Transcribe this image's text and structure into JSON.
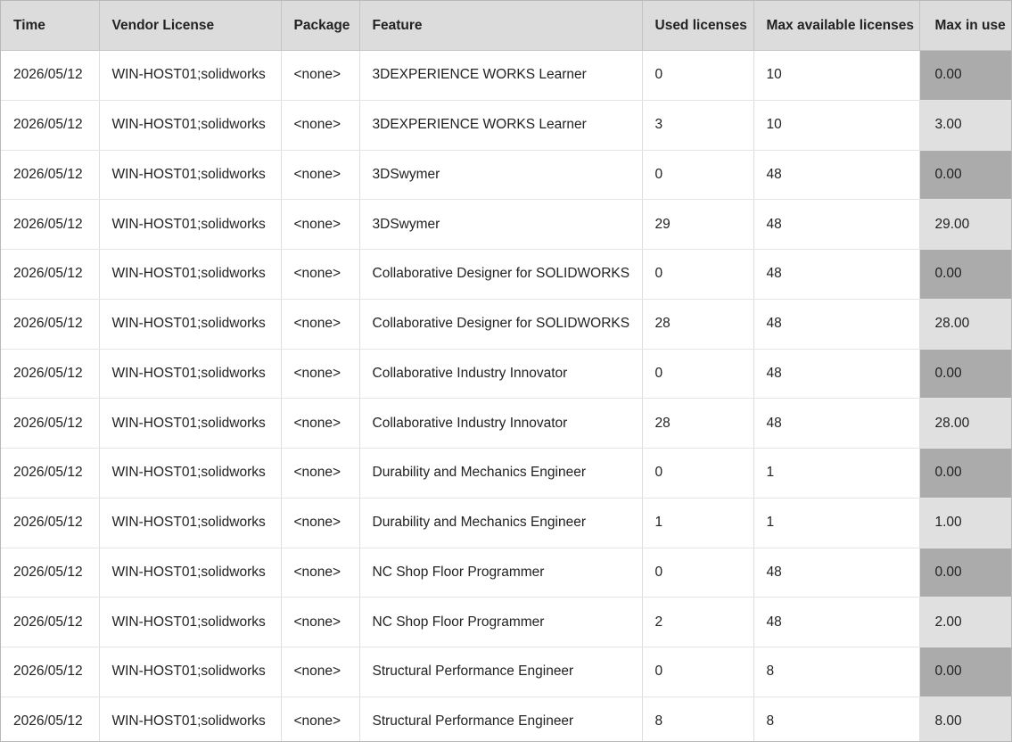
{
  "table": {
    "columns": [
      "Time",
      "Vendor License",
      "Package",
      "Feature",
      "Used licenses",
      "Max available licenses",
      "Max in use"
    ],
    "rows": [
      {
        "time": "2026/05/12",
        "vendor": "WIN-HOST01;solidworks",
        "package": "<none>",
        "feature": "3DEXPERIENCE WORKS Learner",
        "used": "0",
        "max": "10",
        "inuse": "0.00"
      },
      {
        "time": "2026/05/12",
        "vendor": "WIN-HOST01;solidworks",
        "package": "<none>",
        "feature": "3DEXPERIENCE WORKS Learner",
        "used": "3",
        "max": "10",
        "inuse": "3.00"
      },
      {
        "time": "2026/05/12",
        "vendor": "WIN-HOST01;solidworks",
        "package": "<none>",
        "feature": "3DSwymer",
        "used": "0",
        "max": "48",
        "inuse": "0.00"
      },
      {
        "time": "2026/05/12",
        "vendor": "WIN-HOST01;solidworks",
        "package": "<none>",
        "feature": "3DSwymer",
        "used": "29",
        "max": "48",
        "inuse": "29.00"
      },
      {
        "time": "2026/05/12",
        "vendor": "WIN-HOST01;solidworks",
        "package": "<none>",
        "feature": "Collaborative Designer for SOLIDWORKS",
        "used": "0",
        "max": "48",
        "inuse": "0.00"
      },
      {
        "time": "2026/05/12",
        "vendor": "WIN-HOST01;solidworks",
        "package": "<none>",
        "feature": "Collaborative Designer for SOLIDWORKS",
        "used": "28",
        "max": "48",
        "inuse": "28.00"
      },
      {
        "time": "2026/05/12",
        "vendor": "WIN-HOST01;solidworks",
        "package": "<none>",
        "feature": "Collaborative Industry Innovator",
        "used": "0",
        "max": "48",
        "inuse": "0.00"
      },
      {
        "time": "2026/05/12",
        "vendor": "WIN-HOST01;solidworks",
        "package": "<none>",
        "feature": "Collaborative Industry Innovator",
        "used": "28",
        "max": "48",
        "inuse": "28.00"
      },
      {
        "time": "2026/05/12",
        "vendor": "WIN-HOST01;solidworks",
        "package": "<none>",
        "feature": "Durability and Mechanics Engineer",
        "used": "0",
        "max": "1",
        "inuse": "0.00"
      },
      {
        "time": "2026/05/12",
        "vendor": "WIN-HOST01;solidworks",
        "package": "<none>",
        "feature": "Durability and Mechanics Engineer",
        "used": "1",
        "max": "1",
        "inuse": "1.00"
      },
      {
        "time": "2026/05/12",
        "vendor": "WIN-HOST01;solidworks",
        "package": "<none>",
        "feature": "NC Shop Floor Programmer",
        "used": "0",
        "max": "48",
        "inuse": "0.00"
      },
      {
        "time": "2026/05/12",
        "vendor": "WIN-HOST01;solidworks",
        "package": "<none>",
        "feature": "NC Shop Floor Programmer",
        "used": "2",
        "max": "48",
        "inuse": "2.00"
      },
      {
        "time": "2026/05/12",
        "vendor": "WIN-HOST01;solidworks",
        "package": "<none>",
        "feature": "Structural Performance Engineer",
        "used": "0",
        "max": "8",
        "inuse": "0.00"
      },
      {
        "time": "2026/05/12",
        "vendor": "WIN-HOST01;solidworks",
        "package": "<none>",
        "feature": "Structural Performance Engineer",
        "used": "8",
        "max": "8",
        "inuse": "8.00"
      }
    ]
  },
  "colors": {
    "header_bg": "#dcdcdc",
    "inuse_zero_bg": "#ababab",
    "inuse_positive_bg": "#e0e0e0"
  }
}
